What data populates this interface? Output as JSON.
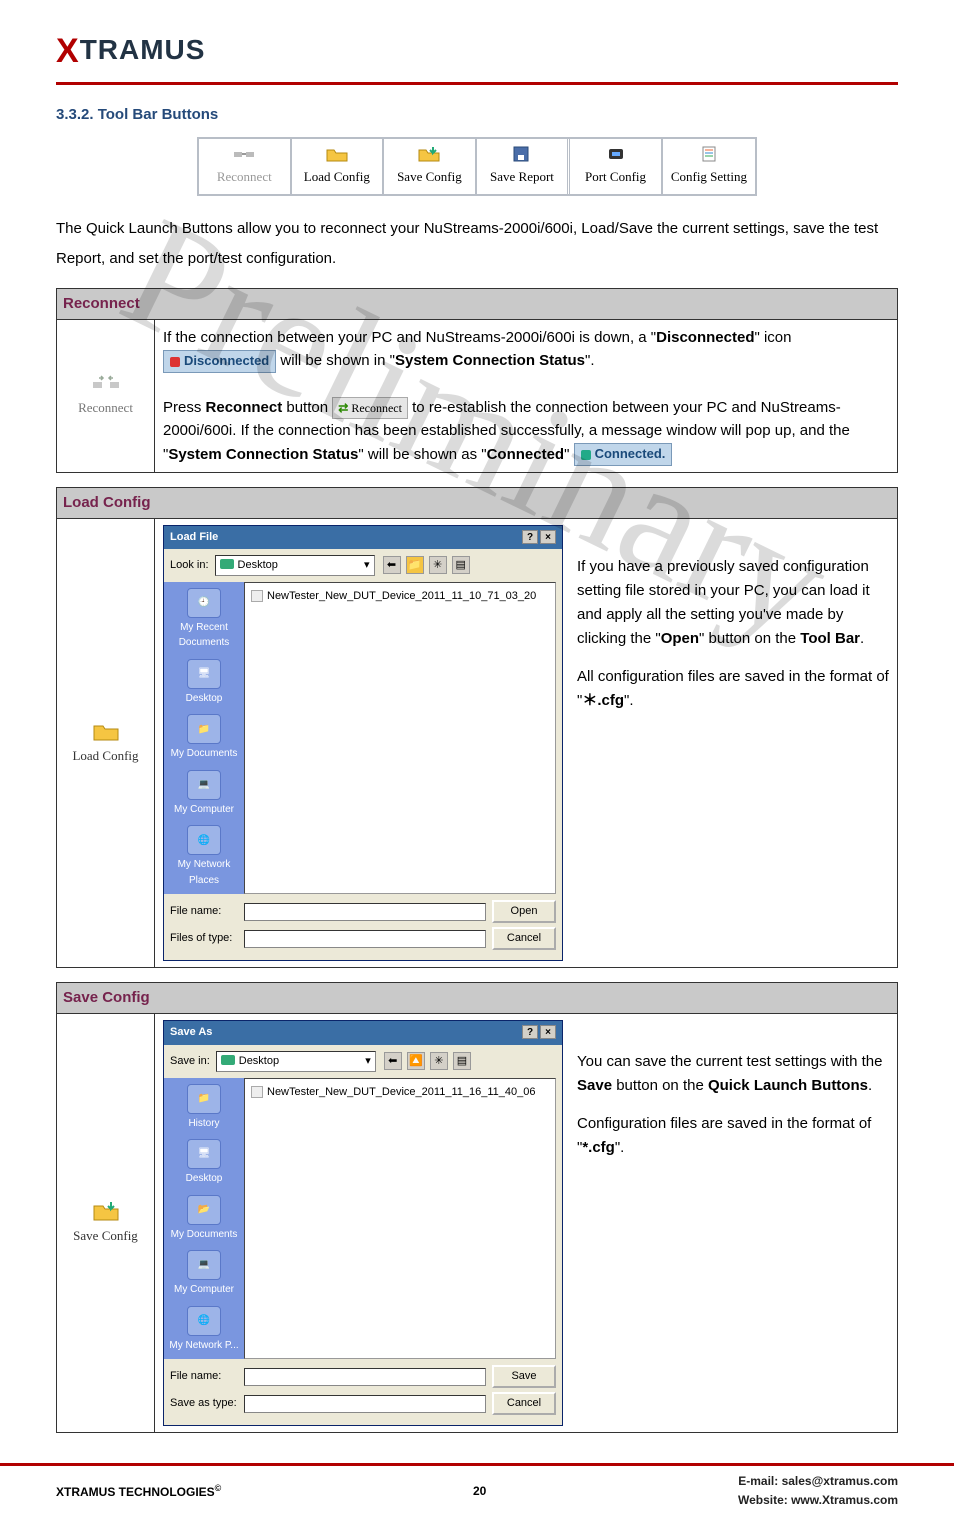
{
  "brand": {
    "x": "X",
    "rest": "TRAMUS"
  },
  "section_heading": "3.3.2. Tool Bar Buttons",
  "toolbar": {
    "cells": [
      {
        "label": "Reconnect",
        "disabled": true
      },
      {
        "label": "Load Config",
        "disabled": false
      },
      {
        "label": "Save Config",
        "disabled": false
      },
      {
        "label": "Save Report",
        "disabled": false
      },
      {
        "label": "Port Config",
        "disabled": false
      },
      {
        "label": "Config Setting",
        "disabled": false
      }
    ]
  },
  "intro_para": "The Quick Launch Buttons allow you to reconnect your NuStreams-2000i/600i, Load/Save the current settings, save the test Report, and set the port/test configuration.",
  "reconnect": {
    "title": "Reconnect",
    "left_label": "Reconnect",
    "line1_pre": "If the connection between your PC and NuStreams-2000i/600i is down, a \"",
    "disconnected_word": "Disconnected",
    "line1_post": "\" icon",
    "disc_pill": "Disconnected",
    "line2_post": " will be shown in \"",
    "scs": "System Connection Status",
    "line2_end": "\".",
    "line3_pre": "Press ",
    "reconnect_word": "Reconnect",
    "line3_mid": " button ",
    "mini_label": "Reconnect",
    "line3_post": " to re-establish the connection between your PC and NuStreams-2000i/600i. If the connection has been established successfully, a message window will pop up, and the \"",
    "scs2": "System Connection Status",
    "line3_mid2": "\" will be shown as \"",
    "connected_word": "Connected",
    "line3_end": "\"",
    "conn_pill": "Connected."
  },
  "loadcfg": {
    "title": "Load Config",
    "left_label": "Load Config",
    "dlg_title": "Load File",
    "lookin_label": "Look in:",
    "lookin_value": "Desktop",
    "file_item": "NewTester_New_DUT_Device_2011_11_10_71_03_20",
    "places": [
      "My Recent Documents",
      "Desktop",
      "My Documents",
      "My Computer",
      "My Network Places"
    ],
    "filename_label": "File name:",
    "filetype_label": "Files of type:",
    "open_btn": "Open",
    "cancel_btn": "Cancel",
    "side1_pre": "If you have a previously saved configuration setting file stored in your PC, you can load it and apply all the setting you've made by clicking the \"",
    "open_bold": "Open",
    "side1_mid": "\" button on the ",
    "toolbar_bold": "Tool Bar",
    "side1_end": ".",
    "side2_pre": "All configuration files are saved in the format of \"",
    "ext": "＊.cfg",
    "side2_end": "\"."
  },
  "savecfg": {
    "title": "Save Config",
    "left_label": "Save Config",
    "dlg_title": "Save As",
    "savein_label": "Save in:",
    "savein_value": "Desktop",
    "file_item": "NewTester_New_DUT_Device_2011_11_16_11_40_06",
    "places": [
      "History",
      "Desktop",
      "My Documents",
      "My Computer",
      "My Network P..."
    ],
    "filename_label": "File name:",
    "saveastype_label": "Save as type:",
    "save_btn": "Save",
    "cancel_btn": "Cancel",
    "side1_pre": "You can save the current test settings with the ",
    "save_bold": "Save",
    "side1_mid": " button on the ",
    "ql_bold": "Quick Launch Buttons",
    "side1_end": ".",
    "side2_pre": "Configuration files are saved in the format of \"",
    "ext": "*.cfg",
    "side2_end": "\"."
  },
  "watermark": "Preliminary",
  "footer": {
    "left_pre": "XTRAMUS TECHNOLOGIES",
    "left_sup": "©",
    "page": "20",
    "email_label": "E-mail: ",
    "email": "sales@xtramus.com",
    "web_label": "Website:  ",
    "web": "www.Xtramus.com"
  }
}
